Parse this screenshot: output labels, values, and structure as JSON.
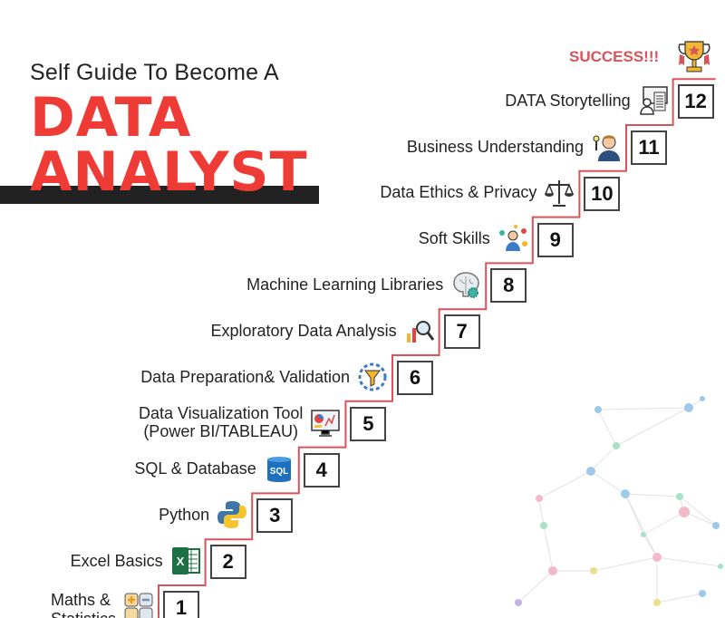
{
  "header": {
    "subtitle": "Self Guide To Become A",
    "title_line1": "DATA",
    "title_line2": "ANALYST"
  },
  "success": {
    "label": "SUCCESS!!!",
    "icon": "trophy-icon"
  },
  "colors": {
    "accent": "#ef3b36",
    "line": "#d9535b",
    "dark": "#222222"
  },
  "steps": [
    {
      "number": "1",
      "label": "Maths &\nStatistics",
      "icon": "math-operators-icon"
    },
    {
      "number": "2",
      "label": "Excel Basics",
      "icon": "excel-icon"
    },
    {
      "number": "3",
      "label": "Python",
      "icon": "python-icon"
    },
    {
      "number": "4",
      "label": "SQL & Database",
      "icon": "sql-database-icon"
    },
    {
      "number": "5",
      "label": "Data Visualization Tool\n(Power BI/TABLEAU)",
      "icon": "dashboard-monitor-icon"
    },
    {
      "number": "6",
      "label": "Data Preparation& Validation",
      "icon": "funnel-gear-icon"
    },
    {
      "number": "7",
      "label": "Exploratory Data Analysis",
      "icon": "chart-magnifier-icon"
    },
    {
      "number": "8",
      "label": "Machine Learning Libraries",
      "icon": "brain-gear-icon"
    },
    {
      "number": "9",
      "label": "Soft Skills",
      "icon": "people-network-icon"
    },
    {
      "number": "10",
      "label": "Data Ethics & Privacy",
      "icon": "scales-icon"
    },
    {
      "number": "11",
      "label": "Business Understanding",
      "icon": "businessman-idea-icon"
    },
    {
      "number": "12",
      "label": "DATA Storytelling",
      "icon": "presentation-board-icon"
    }
  ]
}
